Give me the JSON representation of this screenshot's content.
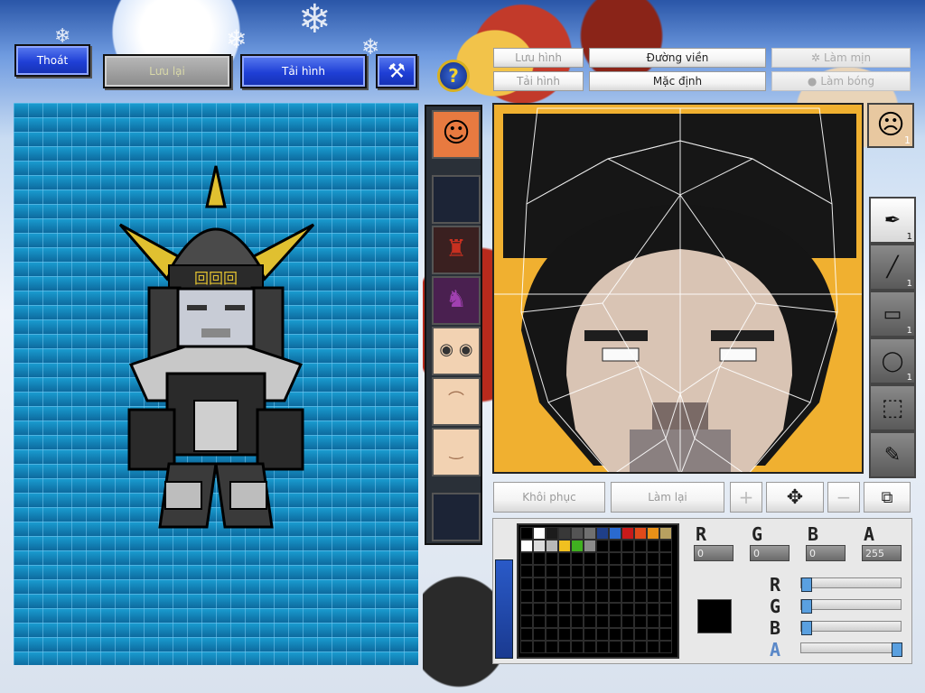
{
  "toolbar": {
    "exit_label": "Thoát",
    "save_label": "Lưu lại",
    "reload_label": "Tải hình"
  },
  "editor_tabs": {
    "save_image": "Lưu hình",
    "load_image": "Tải hình",
    "outline": "Đường viền",
    "default": "Mặc định",
    "smooth": "Làm mịn",
    "shade": "Làm bóng"
  },
  "tools": [
    {
      "icon": "pen-icon",
      "count": "1"
    },
    {
      "icon": "line-icon",
      "count": "1"
    },
    {
      "icon": "rectangle-icon",
      "count": "1"
    },
    {
      "icon": "ellipse-icon",
      "count": "1"
    },
    {
      "icon": "selection-icon",
      "count": ""
    },
    {
      "icon": "eyedropper-icon",
      "count": ""
    }
  ],
  "face_badge_count": "1",
  "actions": {
    "restore": "Khôi phục",
    "redo": "Làm lại"
  },
  "color": {
    "r_label": "R",
    "g_label": "G",
    "b_label": "B",
    "a_label": "A",
    "r": "0",
    "g": "0",
    "b": "0",
    "a": "255",
    "current_hex": "#000000"
  },
  "palette_colors": [
    "#000000",
    "#ffffff",
    "#1c1c1c",
    "#383838",
    "#545454",
    "#707070",
    "#1f3f8a",
    "#2a6ad0",
    "#c81a1a",
    "#e04a1a",
    "#e89018",
    "#b8a060",
    "#ffffff",
    "#dcdcdc",
    "#b8b8b8",
    "#f0c020",
    "#40b020",
    "#8a8a8a"
  ],
  "sliders": {
    "r": 0.0,
    "g": 0.0,
    "b": 0.0,
    "a": 1.0
  }
}
